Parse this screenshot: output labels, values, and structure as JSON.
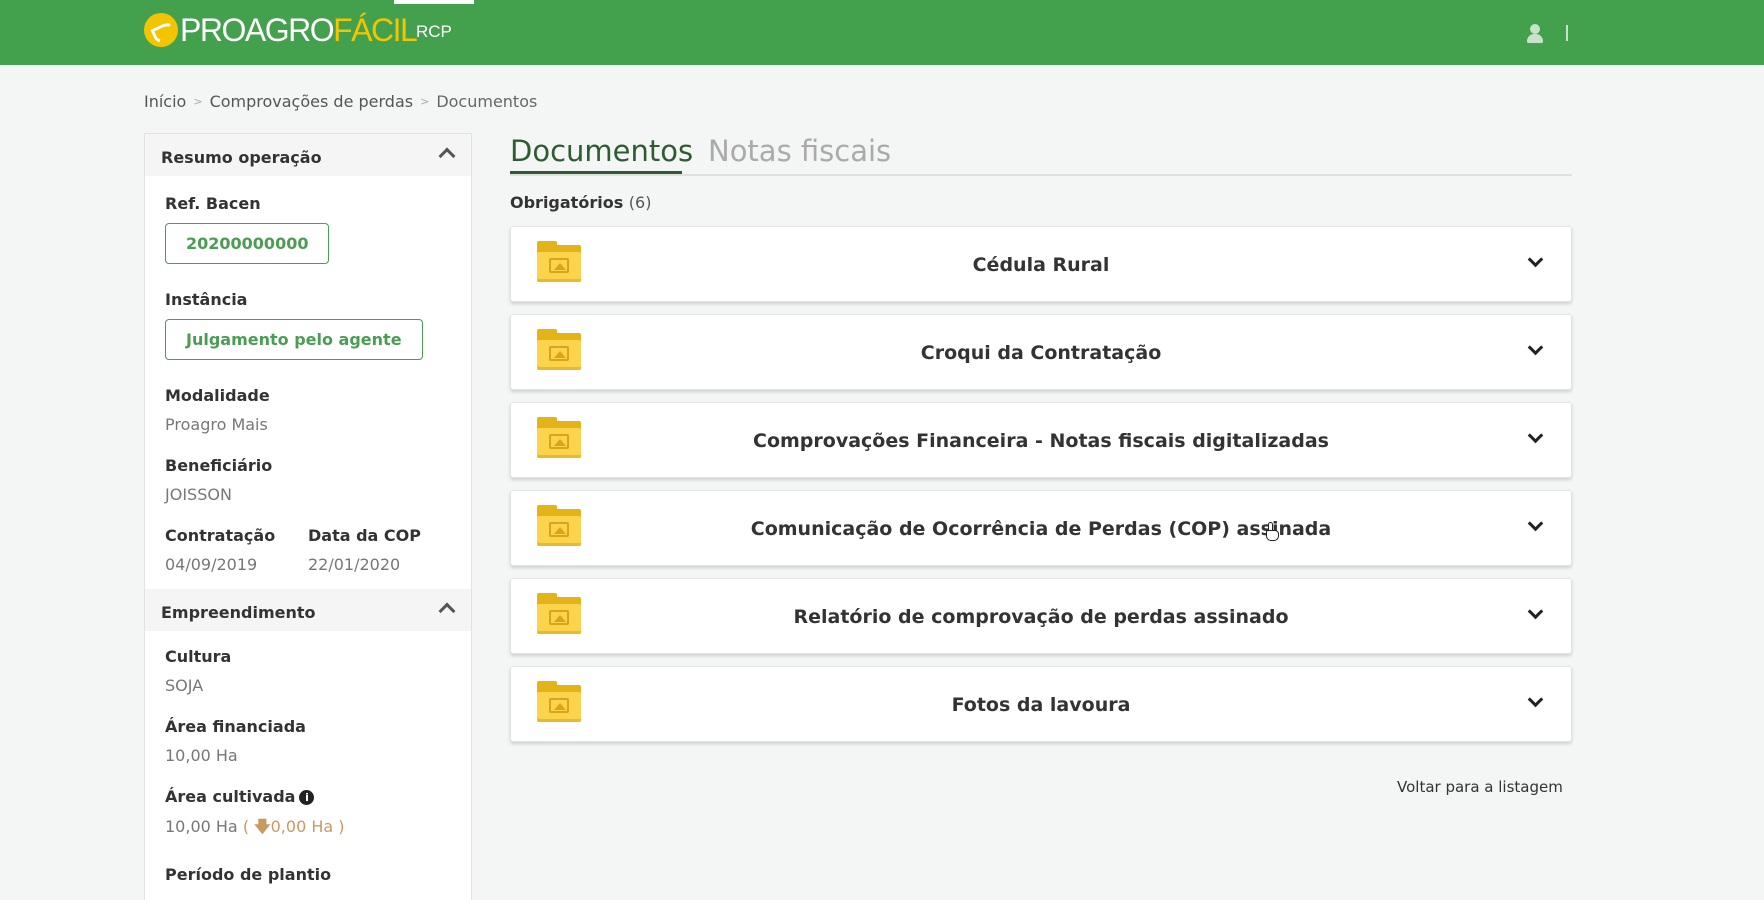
{
  "header": {
    "logo_part1": "PROAGRO",
    "logo_part2": "FÁCIL",
    "nav_item": "RCP",
    "brand_color": "#43a04d",
    "accent_color": "#f2c500"
  },
  "breadcrumb": {
    "items": [
      "Início",
      "Comprovações de perdas",
      "Documentos"
    ],
    "separator": ">"
  },
  "sidebar": {
    "resumo": {
      "title": "Resumo operação",
      "ref_bacen_label": "Ref. Bacen",
      "ref_bacen_value": "20200000000",
      "instancia_label": "Instância",
      "instancia_value": "Julgamento pelo agente",
      "modalidade_label": "Modalidade",
      "modalidade_value": "Proagro Mais",
      "beneficiario_label": "Beneficiário",
      "beneficiario_value": "JOISSON",
      "contratacao_label": "Contratação",
      "contratacao_value": "04/09/2019",
      "data_cop_label": "Data da COP",
      "data_cop_value": "22/01/2020"
    },
    "empreendimento": {
      "title": "Empreendimento",
      "cultura_label": "Cultura",
      "cultura_value": "SOJA",
      "area_financiada_label": "Área financiada",
      "area_financiada_value": "10,00 Ha",
      "area_cultivada_label": "Área cultivada",
      "area_cultivada_value": "10,00 Ha",
      "area_cultivada_open": "(",
      "area_cultivada_diff": "0,00 Ha",
      "area_cultivada_close": ")",
      "periodo_label": "Período de plantio"
    }
  },
  "main": {
    "tabs": [
      {
        "label": "Documentos",
        "active": true
      },
      {
        "label": "Notas fiscais",
        "active": false
      }
    ],
    "section_label": "Obrigatórios",
    "section_count": "(6)",
    "documents": [
      {
        "title": "Cédula Rural",
        "icon": "folder-image-icon"
      },
      {
        "title": "Croqui da Contratação",
        "icon": "folder-image-icon"
      },
      {
        "title": "Comprovações Financeira - Notas fiscais digitalizadas",
        "icon": "folder-image-icon"
      },
      {
        "title": "Comunicação de Ocorrência de Perdas (COP) assinada",
        "icon": "folder-image-icon"
      },
      {
        "title": "Relatório de comprovação de perdas assinado",
        "icon": "folder-image-icon"
      },
      {
        "title": "Fotos da lavoura",
        "icon": "folder-image-icon"
      }
    ],
    "back_link": "Voltar para a listagem"
  }
}
